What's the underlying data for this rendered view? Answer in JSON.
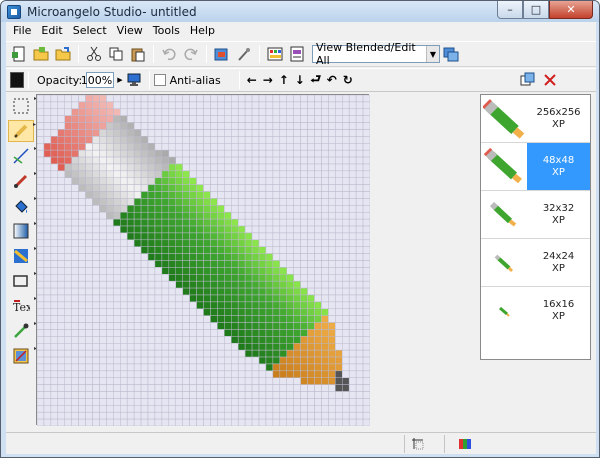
{
  "window": {
    "title": "Microangelo Studio- untitled",
    "minimize": "–",
    "maximize": "□",
    "close": "✕"
  },
  "menu": [
    {
      "label": "File"
    },
    {
      "label": "Edit"
    },
    {
      "label": "Select"
    },
    {
      "label": "View"
    },
    {
      "label": "Tools"
    },
    {
      "label": "Help"
    }
  ],
  "toolbar": {
    "view_mode": "View Blended/Edit All",
    "dropdown_arrow": "▼"
  },
  "toolbar2": {
    "opacity_label": "Opacity:",
    "opacity_value": "100%",
    "antialias_label": "Anti-alias",
    "nudge_left": "←",
    "nudge_right": "→",
    "nudge_up": "↑",
    "nudge_down": "↓",
    "flip_h": "⮐",
    "rotate_ccw": "↶",
    "rotate_cw": "↻"
  },
  "sizes": [
    {
      "size": "256x256",
      "format": "XP",
      "selected": false
    },
    {
      "size": "48x48",
      "format": "XP",
      "selected": true
    },
    {
      "size": "32x32",
      "format": "XP",
      "selected": false
    },
    {
      "size": "24x24",
      "format": "XP",
      "selected": false
    },
    {
      "size": "16x16",
      "format": "XP",
      "selected": false
    }
  ],
  "colors": {
    "accent_selected": "#3399ff",
    "pencil_green": "#3ea62e",
    "pencil_light": "#8ee74c",
    "eraser_red": "#e05a4e",
    "ferrule_gray": "#b9b9b9",
    "wood": "#f1b04a"
  }
}
